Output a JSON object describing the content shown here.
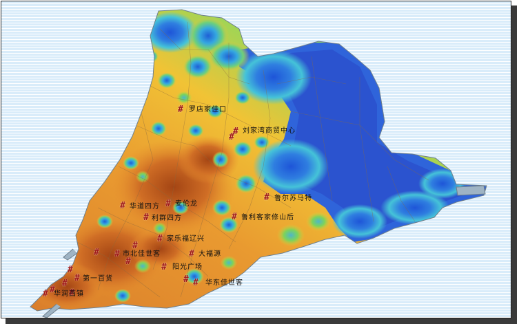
{
  "map": {
    "colors": {
      "sea": "#d9ecfa",
      "low": "#2a5fd8",
      "mid": "#3fb9d6",
      "green": "#7ed05a",
      "yellow": "#f2c234",
      "orange": "#e5892d",
      "high": "#b8551d",
      "boundary": "#8a6a40",
      "marker": "#a01818"
    },
    "labels": [
      {
        "id": "l1",
        "text": "罗店家佳口"
      },
      {
        "id": "l2",
        "text": "刘家湾商贸中心"
      },
      {
        "id": "l3",
        "text": "华道四方"
      },
      {
        "id": "l4",
        "text": "麦伦龙"
      },
      {
        "id": "l5",
        "text": "鲁尔苏马特"
      },
      {
        "id": "l6",
        "text": "利群四方"
      },
      {
        "id": "l7",
        "text": "鲁利客家修山后"
      },
      {
        "id": "l8",
        "text": "家乐福辽兴"
      },
      {
        "id": "l9",
        "text": "市北佳世客"
      },
      {
        "id": "l10",
        "text": "大福源"
      },
      {
        "id": "l11",
        "text": "阳光广场"
      },
      {
        "id": "l12",
        "text": "第一百货"
      },
      {
        "id": "l13",
        "text": "华东佳世客"
      },
      {
        "id": "l14",
        "text": "华润西镇"
      }
    ],
    "marker_symbol": "#"
  }
}
